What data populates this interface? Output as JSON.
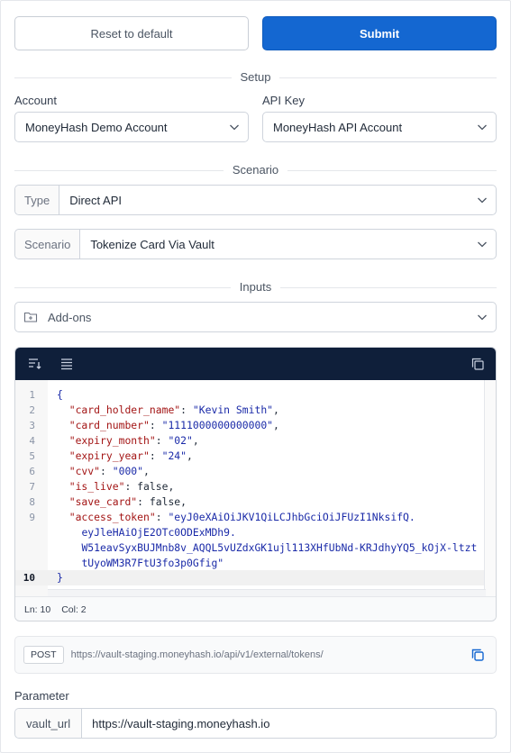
{
  "actions": {
    "reset_label": "Reset to default",
    "submit_label": "Submit"
  },
  "sections": {
    "setup": "Setup",
    "scenario": "Scenario",
    "inputs": "Inputs"
  },
  "setup": {
    "account_label": "Account",
    "account_value": "MoneyHash Demo Account",
    "api_key_label": "API Key",
    "api_key_value": "MoneyHash API Account"
  },
  "scenario": {
    "type_prefix": "Type",
    "type_value": "Direct API",
    "scenario_prefix": "Scenario",
    "scenario_value": "Tokenize Card Via Vault"
  },
  "inputs": {
    "addons_label": "Add-ons"
  },
  "editor": {
    "line_numbers": [
      "1",
      "2",
      "3",
      "4",
      "5",
      "6",
      "7",
      "8",
      "9",
      "10"
    ],
    "code": {
      "open": "{",
      "card_holder_name_key": "\"card_holder_name\"",
      "card_holder_name_val": "\"Kevin Smith\"",
      "card_number_key": "\"card_number\"",
      "card_number_val": "\"1111000000000000\"",
      "expiry_month_key": "\"expiry_month\"",
      "expiry_month_val": "\"02\"",
      "expiry_year_key": "\"expiry_year\"",
      "expiry_year_val": "\"24\"",
      "cvv_key": "\"cvv\"",
      "cvv_val": "\"000\"",
      "is_live_key": "\"is_live\"",
      "is_live_val": "false",
      "save_card_key": "\"save_card\"",
      "save_card_val": "false",
      "access_token_key": "\"access_token\"",
      "access_token_val_1": "\"eyJ0eXAiOiJKV1QiLCJhbGciOiJFUzI1NksifQ.",
      "access_token_val_2": "eyJleHAiOjE2OTc0ODExMDh9.",
      "access_token_val_3": "W51eavSyxBUJMnb8v_AQQL5vUZdxGK1ujl113XHfUbNd-KRJdhyYQ5_kOjX-ltzt",
      "access_token_val_4": "tUyoWM3R7FtU3fo3p0Gfig\"",
      "close": "}"
    },
    "status_ln": "Ln: 10",
    "status_col": "Col: 2"
  },
  "endpoint": {
    "method": "POST",
    "url": "https://vault-staging.moneyhash.io/api/v1/external/tokens/"
  },
  "parameter": {
    "label": "Parameter",
    "name": "vault_url",
    "value": "https://vault-staging.moneyhash.io"
  },
  "icons": [
    "chevron-down-icon",
    "folder-plus-icon",
    "sort-icon",
    "format-lines-icon",
    "copy-icon"
  ],
  "colors": {
    "primary": "#1467d1",
    "editor_toolbar": "#0f1f3a"
  }
}
